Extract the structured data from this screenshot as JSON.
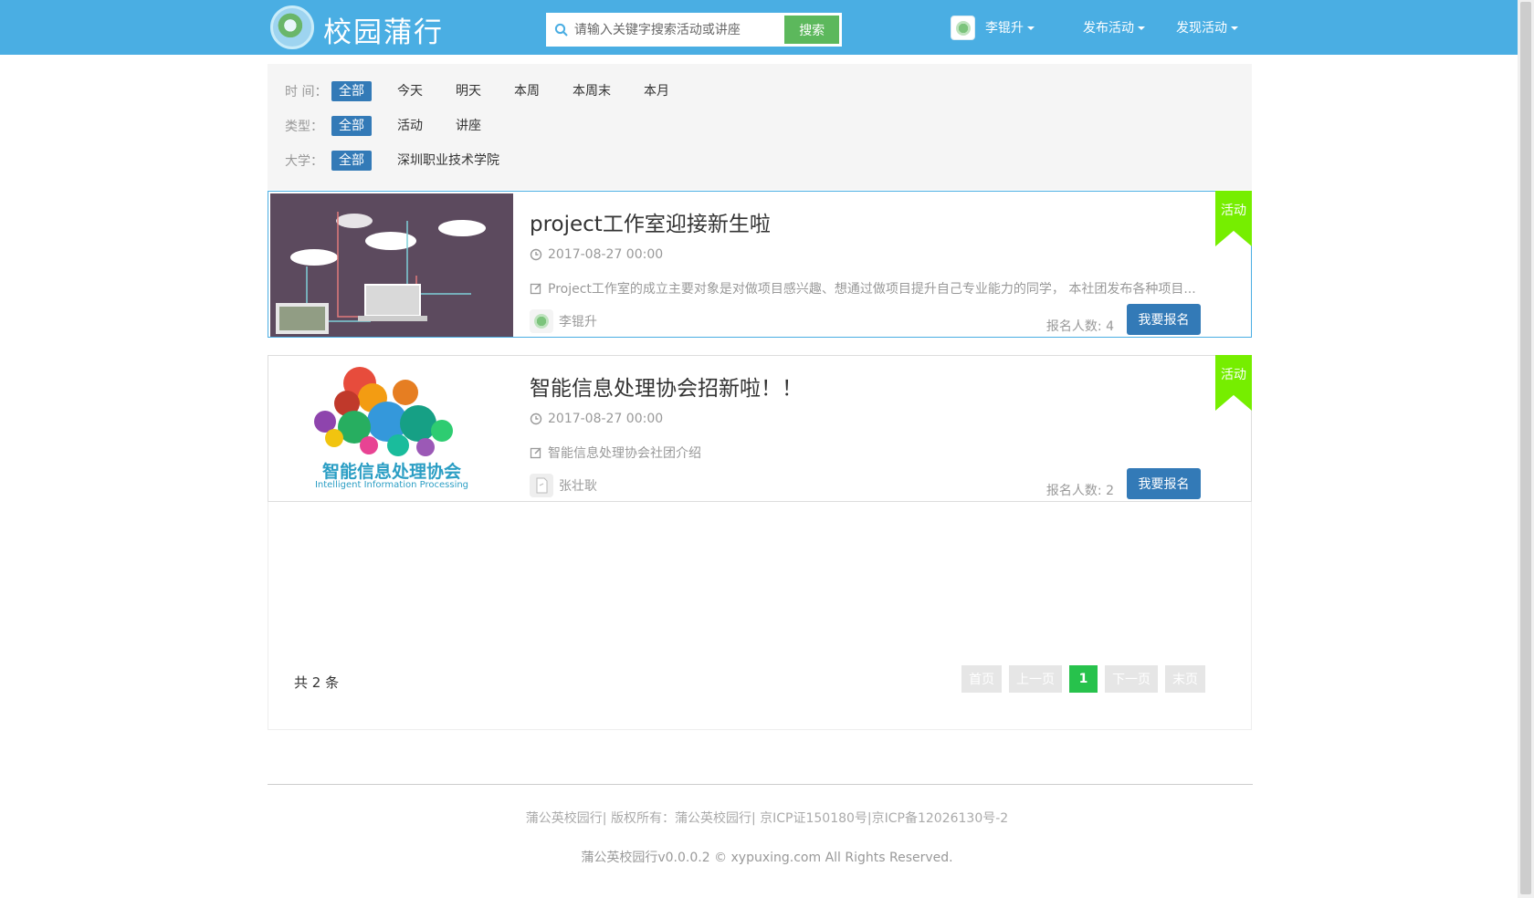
{
  "header": {
    "logo_text": "校园蒲行",
    "search_placeholder": "请输入关键字搜索活动或讲座",
    "search_button": "搜索",
    "user_name": "李锟升",
    "publish_menu": "发布活动",
    "discover_menu": "发现活动"
  },
  "filters": {
    "time": {
      "label": "时 间：",
      "options": [
        "全部",
        "今天",
        "明天",
        "本周",
        "本周末",
        "本月"
      ]
    },
    "type": {
      "label": "类型：",
      "options": [
        "全部",
        "活动",
        "讲座"
      ]
    },
    "school": {
      "label": "大学：",
      "options": [
        "全部",
        "深圳职业技术学院"
      ]
    }
  },
  "events": [
    {
      "title": "project工作室迎接新生啦",
      "datetime": "2017-08-27 00:00",
      "description": "Project工作室的成立主要对象是对做项目感兴趣、想通过做项目提升自己专业能力的同学， 本社团发布各种项目...",
      "organizer": "李锟升",
      "enroll_label": "报名人数: ",
      "enroll_count": "4",
      "signup": "我要报名",
      "tag": "活动"
    },
    {
      "title": "智能信息处理协会招新啦！！",
      "datetime": "2017-08-27 00:00",
      "description": "智能信息处理协会社团介绍",
      "organizer": "张壮耿",
      "enroll_label": "报名人数: ",
      "enroll_count": "2",
      "signup": "我要报名",
      "tag": "活动",
      "image_text_cn": "智能信息处理协会",
      "image_text_en": "Intelligent Information Processing"
    }
  ],
  "pagination": {
    "total": "共 2 条",
    "first": "首页",
    "prev": "上一页",
    "current": "1",
    "next": "下一页",
    "last": "末页"
  },
  "footer": {
    "line1": "蒲公英校园行| 版权所有：蒲公英校园行| 京ICP证150180号|京ICP备12026130号-2",
    "line2": "蒲公英校园行v0.0.0.2 © xypuxing.com All Rights Reserved."
  },
  "colors": {
    "header": "#4aaee3",
    "primary": "#337ab7",
    "success": "#5cb85c",
    "ribbon": "#76ee00",
    "pager_current": "#27c24c"
  }
}
